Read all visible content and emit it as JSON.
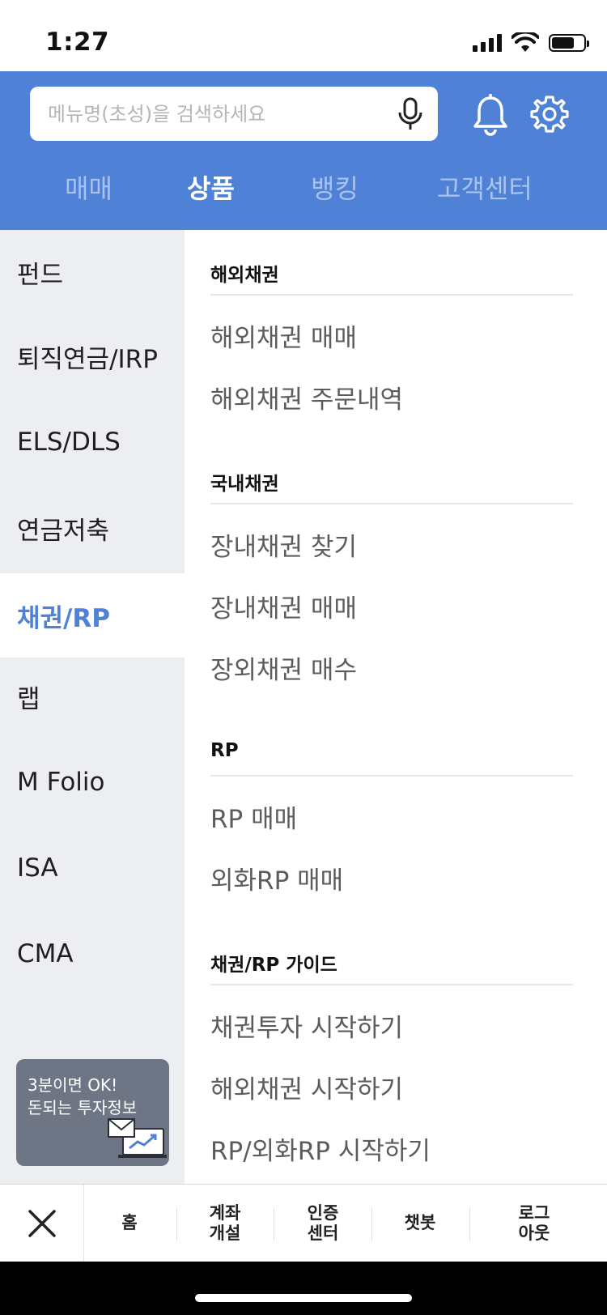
{
  "status_bar": {
    "time": "1:27"
  },
  "header": {
    "search_placeholder": "메뉴명(초성)을 검색하세요",
    "tabs": [
      "매매",
      "상품",
      "뱅킹",
      "고객센터"
    ],
    "active_tab": "상품"
  },
  "sidebar": {
    "items": [
      "펀드",
      "퇴직연금/IRP",
      "ELS/DLS",
      "연금저축",
      "채권/RP",
      "랩",
      "M Folio",
      "ISA",
      "CMA"
    ],
    "active_item": "채권/RP",
    "promo": {
      "line1": "3분이면 OK!",
      "line2": "돈되는 투자정보"
    }
  },
  "content": {
    "sections": [
      {
        "title": "해외채권",
        "links": [
          "해외채권 매매",
          "해외채권 주문내역"
        ]
      },
      {
        "title": "국내채권",
        "links": [
          "장내채권 찾기",
          "장내채권 매매",
          "장외채권 매수"
        ]
      },
      {
        "title": "RP",
        "links": [
          "RP 매매",
          "외화RP 매매"
        ]
      },
      {
        "title": "채권/RP 가이드",
        "links": [
          "채권투자 시작하기",
          "해외채권 시작하기",
          "RP/외화RP 시작하기"
        ]
      }
    ]
  },
  "bottom_bar": {
    "items": [
      "홈",
      "계좌\n개설",
      "인증\n센터",
      "챗봇",
      "로그\n아웃"
    ]
  },
  "colors": {
    "brand_blue": "#4f81d6",
    "sidebar_bg": "#eceef2",
    "promo_bg": "#6e7685"
  },
  "icons": [
    "signal-icon",
    "wifi-icon",
    "battery-icon",
    "microphone-icon",
    "bell-icon",
    "gear-icon",
    "close-icon",
    "mail-chart-icon"
  ]
}
